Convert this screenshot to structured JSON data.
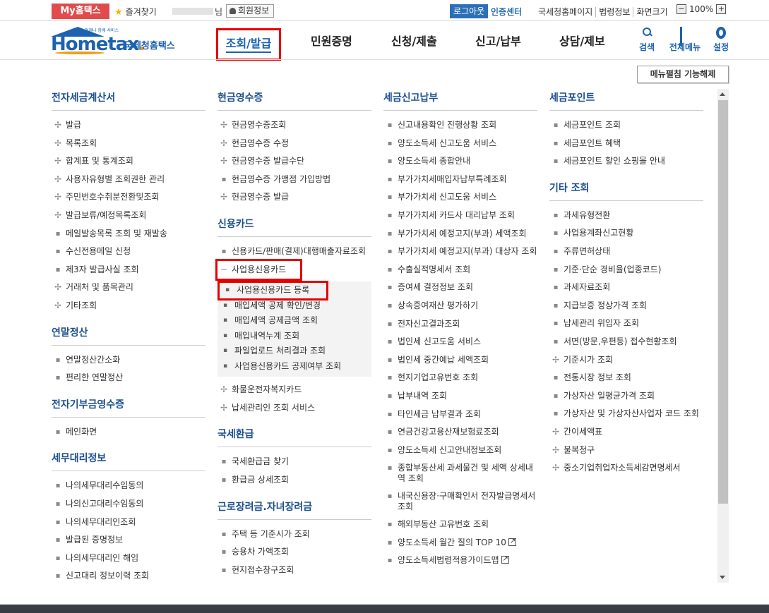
{
  "topbar": {
    "my_label": "My홈택스",
    "favorites_label": "즐겨찾기",
    "user_suffix": "님",
    "member_label": "회원정보",
    "logout_label": "로그아웃",
    "cert_label": "인증센터",
    "links": [
      "국세청홈페이지",
      "법령정보",
      "화면크기"
    ],
    "zoom_value": "100%",
    "zoom_minus": "−",
    "zoom_plus": "+"
  },
  "logo": {
    "sub": "언제나 함께 서비스",
    "home": "Hometax",
    "dot": ".",
    "kr": "국세청홈택스"
  },
  "gnb": {
    "items": [
      "조회/발급",
      "민원증명",
      "신청/제출",
      "신고/납부",
      "상담/제보"
    ],
    "active_index": 0
  },
  "tools": {
    "search": "검색",
    "all_menu": "전체메뉴",
    "settings": "설정"
  },
  "collapse_button": "메뉴펼침 기능해제",
  "col1": {
    "sections": [
      {
        "title": "전자세금계산서",
        "items": [
          {
            "label": "발급",
            "marker": "plus"
          },
          {
            "label": "목록조회",
            "marker": "plus"
          },
          {
            "label": "합계표 및 통계조회",
            "marker": "plus"
          },
          {
            "label": "사용자유형별 조회권한 관리",
            "marker": "plus"
          },
          {
            "label": "주민번호수취분전환및조회",
            "marker": "plus"
          },
          {
            "label": "발급보류/예정목록조회",
            "marker": "plus"
          },
          {
            "label": "메일발송목록 조회 및 재발송",
            "marker": "dot"
          },
          {
            "label": "수신전용메일 신청",
            "marker": "dot"
          },
          {
            "label": "제3자 발급사실 조회",
            "marker": "dot"
          },
          {
            "label": "거래처 및 품목관리",
            "marker": "plus"
          },
          {
            "label": "기타조회",
            "marker": "plus"
          }
        ]
      },
      {
        "title": "연말정산",
        "items": [
          {
            "label": "연말정산간소화",
            "marker": "dot"
          },
          {
            "label": "편리한 연말정산",
            "marker": "dot"
          }
        ]
      },
      {
        "title": "전자기부금영수증",
        "items": [
          {
            "label": "메인화면",
            "marker": "dot"
          }
        ]
      },
      {
        "title": "세무대리정보",
        "items": [
          {
            "label": "나의세무대리수임동의",
            "marker": "dot"
          },
          {
            "label": "나의신고대리수임동의",
            "marker": "dot"
          },
          {
            "label": "나의세무대리인조회",
            "marker": "dot"
          },
          {
            "label": "발급된 증명정보",
            "marker": "dot"
          },
          {
            "label": "나의세무대리인 해임",
            "marker": "dot"
          },
          {
            "label": "신고대리 정보이력 조회",
            "marker": "dot"
          }
        ]
      }
    ]
  },
  "col2": {
    "cash": {
      "title": "현금영수증",
      "items": [
        {
          "label": "현금영수증조회",
          "marker": "plus"
        },
        {
          "label": "현금영수증 수정",
          "marker": "plus"
        },
        {
          "label": "현금영수증 발급수단",
          "marker": "plus"
        },
        {
          "label": "현금영수증 가맹점 가입방법",
          "marker": "dot"
        },
        {
          "label": "현금영수증 발급",
          "marker": "plus"
        }
      ]
    },
    "card": {
      "title": "신용카드",
      "item1": "신용카드/판매(결제)대행매출자료조회",
      "expanded": "사업용신용카드",
      "expanded_marker": "−",
      "sub_items": [
        "사업용신용카드 등록",
        "매입세액 공제 확인/변경",
        "매입세액 공제금액 조회",
        "매입내역누계 조회",
        "파일업로드 처리결과 조회",
        "사업용신용카드 공제여부 조회"
      ],
      "after_items": [
        {
          "label": "화물운전자복지카드",
          "marker": "plus"
        },
        {
          "label": "납세관리인 조회 서비스",
          "marker": "plus"
        }
      ]
    },
    "refund": {
      "title": "국세환급",
      "items": [
        {
          "label": "국세환급금 찾기",
          "marker": "dot"
        },
        {
          "label": "환급금 상세조회",
          "marker": "dot"
        }
      ]
    },
    "earned": {
      "title": "근로장려금.자녀장려금",
      "items": [
        {
          "label": "주택 등 기준시가 조회",
          "marker": "dot"
        },
        {
          "label": "승용차 가액조회",
          "marker": "dot"
        },
        {
          "label": "현지접수창구조회",
          "marker": "dot"
        }
      ]
    }
  },
  "col3": {
    "title": "세금신고납부",
    "items": [
      "신고내용확인 진행상황 조회",
      "양도소득세 신고도움 서비스",
      "양도소득세 종합안내",
      "부가가치세매입자납부특례조회",
      "부가가치세 신고도움 서비스",
      "부가가치세 카드사 대리납부 조회",
      "부가가치세 예정고지(부과) 세액조회",
      "부가가치세 예정고지(부과) 대상자 조회",
      "수출실적명세서 조회",
      "증여세 결정정보 조회",
      "상속증여재산 평가하기",
      "전자신고결과조회",
      "법인세 신고도움 서비스",
      "법인세 중간예납 세액조회",
      "현지기업고유번호 조회",
      "납부내역 조회",
      "타인세금 납부결과 조회",
      "연금건강고용산재보험료조회",
      "양도소득세 신고안내정보조회",
      "종합부동산세 과세물건 및 세액 상세내역 조회",
      "내국신용장·구매확인서 전자발급명세서 조회",
      "해외부동산 고유번호 조회",
      "양도소득세 월간 질의 TOP 10",
      "양도소득세법령적용가이드맵"
    ],
    "external_indices": [
      22,
      23
    ]
  },
  "col4": {
    "points": {
      "title": "세금포인트",
      "items": [
        {
          "label": "세금포인트 조회",
          "marker": "dot"
        },
        {
          "label": "세금포인트 혜택",
          "marker": "dot"
        },
        {
          "label": "세금포인트 할인 쇼핑몰 안내",
          "marker": "dot"
        }
      ]
    },
    "etc": {
      "title": "기타 조회",
      "items": [
        {
          "label": "과세유형전환",
          "marker": "dot"
        },
        {
          "label": "사업용계좌신고현황",
          "marker": "dot"
        },
        {
          "label": "주류면허상태",
          "marker": "dot"
        },
        {
          "label": "기준·단순 경비율(업종코드)",
          "marker": "dot"
        },
        {
          "label": "과세자료조회",
          "marker": "dot"
        },
        {
          "label": "지급보증 정상가격 조회",
          "marker": "dot"
        },
        {
          "label": "납세관리 위임자 조회",
          "marker": "dot"
        },
        {
          "label": "서면(방문,우편등) 접수현황조회",
          "marker": "dot"
        },
        {
          "label": "기준시가 조회",
          "marker": "plus"
        },
        {
          "label": "전통시장 정보 조회",
          "marker": "dot"
        },
        {
          "label": "가상자산 일평균가격 조회",
          "marker": "dot"
        },
        {
          "label": "가상자산 및 가상자산사업자 코드 조회",
          "marker": "dot"
        },
        {
          "label": "간이세액표",
          "marker": "plus"
        },
        {
          "label": "불복청구",
          "marker": "plus"
        },
        {
          "label": "중소기업취업자소득세감면명세서",
          "marker": "plus"
        }
      ]
    }
  },
  "colors": {
    "brand_blue": "#1c62b0",
    "title_blue": "#1c4f8f",
    "my_red": "#e14b4b",
    "highlight_red": "#e60000"
  }
}
